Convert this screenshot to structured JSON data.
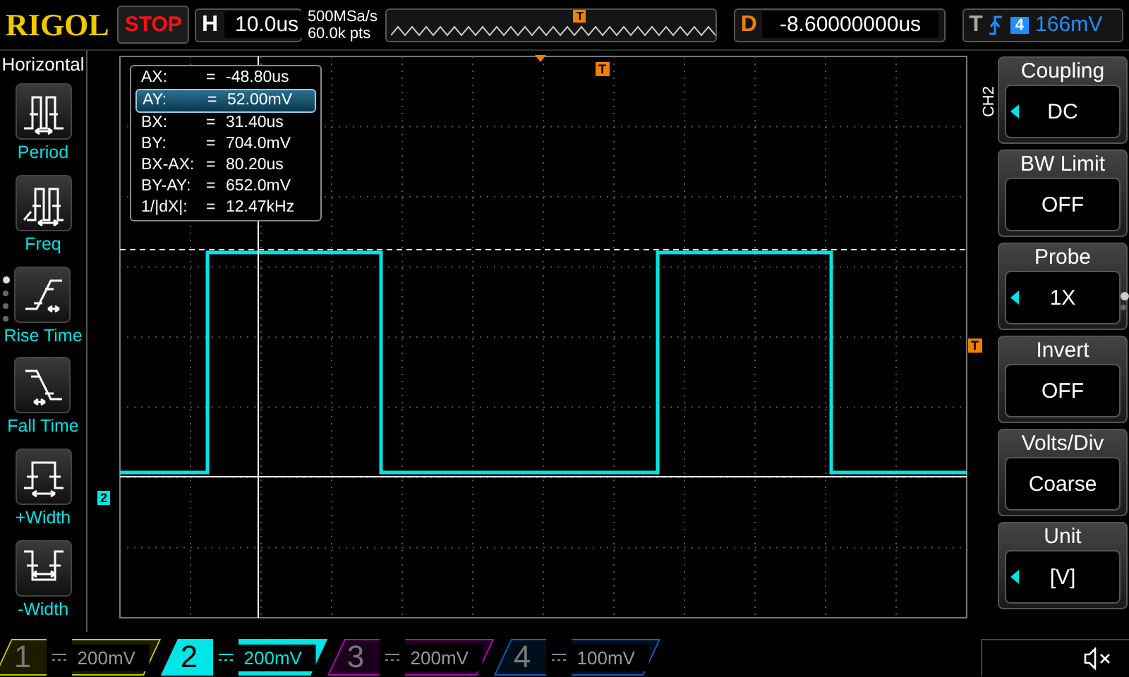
{
  "top_bar": {
    "brand": "RIGOL",
    "run_state": "STOP",
    "horizontal": {
      "label": "H",
      "value": "10.0us"
    },
    "sample_rate": "500MSa/s",
    "memory_depth": "60.0k pts",
    "timeline_marker": "T",
    "delay": {
      "label": "D",
      "value": "-8.60000000us"
    },
    "trigger": {
      "label": "T",
      "source": "4",
      "level": "166mV"
    }
  },
  "left_menu": {
    "title": "Horizontal",
    "pages": [
      {
        "selected": true
      },
      {
        "selected": false
      },
      {
        "selected": false
      },
      {
        "selected": false
      }
    ],
    "items": [
      {
        "kind": "period",
        "label": "Period"
      },
      {
        "kind": "freq",
        "label": "Freq"
      },
      {
        "kind": "rise",
        "label": "Rise Time"
      },
      {
        "kind": "fall",
        "label": "Fall Time"
      },
      {
        "kind": "pos_width",
        "label": "+Width"
      },
      {
        "kind": "neg_width",
        "label": "-Width"
      }
    ]
  },
  "display": {
    "trigger_position_marker": "T",
    "trigger_level_marker": "T",
    "channel_marker": "2",
    "cursor_readout": [
      {
        "label": "AX:",
        "separator": "=",
        "value": "-48.80us",
        "selected": false
      },
      {
        "label": "AY:",
        "separator": "=",
        "value": "52.00mV",
        "selected": true
      },
      {
        "label": "BX:",
        "separator": "=",
        "value": "31.40us",
        "selected": false
      },
      {
        "label": "BY:",
        "separator": "=",
        "value": "704.0mV",
        "selected": false
      },
      {
        "label": "BX-AX:",
        "separator": "=",
        "value": "80.20us",
        "selected": false
      },
      {
        "label": "BY-AY:",
        "separator": "=",
        "value": "652.0mV",
        "selected": false
      },
      {
        "label": "1/|dX|:",
        "separator": "=",
        "value": "12.47kHz",
        "selected": false
      }
    ]
  },
  "right_menu": {
    "channel": "CH2",
    "pages": [
      {
        "selected": true
      },
      {
        "selected": false
      }
    ],
    "items": [
      {
        "title": "Coupling",
        "value": "DC",
        "adjustable": true
      },
      {
        "title": "BW Limit",
        "value": "OFF",
        "adjustable": false
      },
      {
        "title": "Probe",
        "value": "1X",
        "adjustable": true
      },
      {
        "title": "Invert",
        "value": "OFF",
        "adjustable": false
      },
      {
        "title": "Volts/Div",
        "value": "Coarse",
        "adjustable": false
      },
      {
        "title": "Unit",
        "value": "[V]",
        "adjustable": true
      }
    ]
  },
  "channels": [
    {
      "number": "1",
      "scale": "200mV",
      "color": "#c8c800",
      "selected": false
    },
    {
      "number": "2",
      "scale": "200mV",
      "color": "#00e5e5",
      "selected": true
    },
    {
      "number": "3",
      "scale": "200mV",
      "color": "#c000c0",
      "selected": false
    },
    {
      "number": "4",
      "scale": "100mV",
      "color": "#1060c0",
      "selected": false
    }
  ],
  "sound": {
    "muted": true
  }
}
